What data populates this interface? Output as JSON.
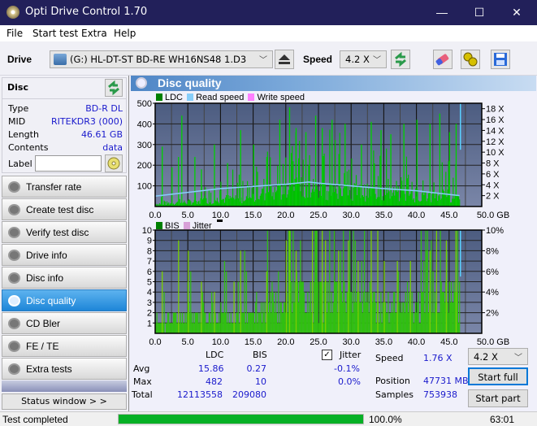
{
  "window": {
    "title": "Opti Drive Control 1.70",
    "minimize": "—",
    "maximize": "☐",
    "close": "✕"
  },
  "menu": [
    "File",
    "Start test",
    "Extra",
    "Help"
  ],
  "toolbar": {
    "drive_label": "Drive",
    "drive_value": "(G:)  HL-DT-ST BD-RE  WH16NS48 1.D3",
    "speed_label": "Speed",
    "speed_value": "4.2 X",
    "icons": [
      "eject-icon",
      "refresh-icon",
      "eraser-icon",
      "settings-icon",
      "save-icon"
    ]
  },
  "disc": {
    "header": "Disc",
    "rows": [
      {
        "label": "Type",
        "value": "BD-R DL"
      },
      {
        "label": "MID",
        "value": "RITEKDR3 (000)"
      },
      {
        "label": "Length",
        "value": "46.61 GB"
      },
      {
        "label": "Contents",
        "value": "data"
      }
    ],
    "label_field_label": "Label",
    "label_field_value": ""
  },
  "nav": [
    {
      "label": "Transfer rate",
      "active": false
    },
    {
      "label": "Create test disc",
      "active": false
    },
    {
      "label": "Verify test disc",
      "active": false
    },
    {
      "label": "Drive info",
      "active": false
    },
    {
      "label": "Disc info",
      "active": false
    },
    {
      "label": "Disc quality",
      "active": true
    },
    {
      "label": "CD Bler",
      "active": false
    },
    {
      "label": "FE / TE",
      "active": false
    },
    {
      "label": "Extra tests",
      "active": false
    }
  ],
  "status_window_button": "Status window > >",
  "panel_title": "Disc quality",
  "chart_data": [
    {
      "type": "bar",
      "title": "LDC / Read speed",
      "legend": [
        {
          "name": "LDC",
          "color": "#008000"
        },
        {
          "name": "Read speed",
          "color": "#87cefa"
        },
        {
          "name": "Write speed",
          "color": "#ff80ff"
        }
      ],
      "legend_position": "top-left",
      "x_ticks": [
        "0.0",
        "5.0",
        "10.0",
        "15.0",
        "20.0",
        "25.0",
        "30.0",
        "35.0",
        "40.0",
        "45.0",
        "50.0 GB"
      ],
      "xlim": [
        0,
        50
      ],
      "y_ticks_left": [
        "100",
        "200",
        "300",
        "400",
        "500"
      ],
      "ylim_left": [
        0,
        500
      ],
      "y_ticks_right": [
        "2 X",
        "4 X",
        "6 X",
        "8 X",
        "10 X",
        "12 X",
        "14 X",
        "16 X",
        "18 X"
      ],
      "ylim_right": [
        0,
        19
      ],
      "grid": true,
      "data_end_gb": 46.61,
      "ldc_baseline": {
        "x": [
          0,
          5,
          10,
          15,
          20,
          23,
          25,
          30,
          35,
          40,
          46.6
        ],
        "y": [
          15,
          25,
          40,
          55,
          90,
          110,
          100,
          85,
          75,
          65,
          60
        ]
      },
      "ldc_peaks": {
        "x": [
          1,
          2.5,
          3.5,
          4,
          6,
          7,
          9,
          11,
          13,
          15,
          17,
          19,
          20.5,
          21.5,
          23,
          24.5,
          25.5,
          27,
          29,
          31.5,
          33,
          34.5,
          36,
          38,
          40,
          42,
          43.5,
          45,
          46
        ],
        "y": [
          290,
          190,
          240,
          440,
          240,
          180,
          300,
          210,
          370,
          300,
          240,
          420,
          480,
          380,
          360,
          440,
          380,
          420,
          400,
          300,
          410,
          370,
          350,
          400,
          420,
          400,
          450,
          360,
          400
        ]
      },
      "read_speed": {
        "x": [
          0,
          5,
          10,
          15,
          20,
          23.5,
          25,
          30,
          35,
          40,
          46.6
        ],
        "y": [
          1.9,
          2.6,
          3.3,
          3.7,
          4.1,
          4.5,
          4.3,
          3.8,
          3.3,
          2.9,
          2.0
        ]
      }
    },
    {
      "type": "bar",
      "title": "BIS / Jitter",
      "legend": [
        {
          "name": "BIS",
          "color": "#008000"
        },
        {
          "name": "Jitter",
          "color": "#d8a0d8"
        }
      ],
      "legend_position": "top-left",
      "x_ticks": [
        "0.0",
        "5.0",
        "10.0",
        "15.0",
        "20.0",
        "25.0",
        "30.0",
        "35.0",
        "40.0",
        "45.0",
        "50.0 GB"
      ],
      "xlim": [
        0,
        50
      ],
      "y_ticks_left": [
        "1",
        "2",
        "3",
        "4",
        "5",
        "6",
        "7",
        "8",
        "9",
        "10"
      ],
      "ylim_left": [
        0,
        10
      ],
      "y_ticks_right": [
        "2%",
        "4%",
        "6%",
        "8%",
        "10%"
      ],
      "ylim_right": [
        0,
        10
      ],
      "grid": true,
      "data_end_gb": 46.61,
      "bis_baseline": {
        "x": [
          0,
          5,
          10,
          15,
          17,
          20,
          25,
          30,
          35,
          40,
          46.6
        ],
        "y": [
          1,
          2,
          2,
          2,
          3,
          4,
          4,
          4,
          3,
          3,
          4
        ]
      },
      "bis_peaks": {
        "x": [
          1,
          3.5,
          5,
          7,
          9,
          12,
          13,
          17,
          20,
          20.5,
          21.5,
          24,
          25.5,
          26,
          28,
          29.5,
          31,
          33,
          34,
          35,
          37,
          39,
          42,
          43,
          44.5,
          46
        ],
        "y": [
          6,
          9,
          8,
          5,
          4,
          5,
          8,
          6,
          9,
          10,
          8,
          10,
          10,
          9,
          8,
          9,
          7,
          10,
          10,
          7,
          7,
          7,
          8,
          10,
          9,
          10
        ]
      }
    }
  ],
  "stats": {
    "col_ldc": "LDC",
    "col_bis": "BIS",
    "rows": [
      {
        "label": "Avg",
        "ldc": "15.86",
        "bis": "0.27"
      },
      {
        "label": "Max",
        "ldc": "482",
        "bis": "10"
      },
      {
        "label": "Total",
        "ldc": "12113558",
        "bis": "209080"
      }
    ],
    "jitter_label": "Jitter",
    "jitter_checked": true,
    "jitter_avg": "-0.1%",
    "jitter_max": "0.0%",
    "speed_label": "Speed",
    "speed_value": "1.76 X",
    "position_label": "Position",
    "position_value": "47731 MB",
    "samples_label": "Samples",
    "samples_value": "753938",
    "speed_select": "4.2 X",
    "start_full": "Start full",
    "start_part": "Start part"
  },
  "statusbar": {
    "text": "Test completed",
    "progress_percent": 100.0,
    "progress_label": "100.0%",
    "time": "63:01"
  }
}
